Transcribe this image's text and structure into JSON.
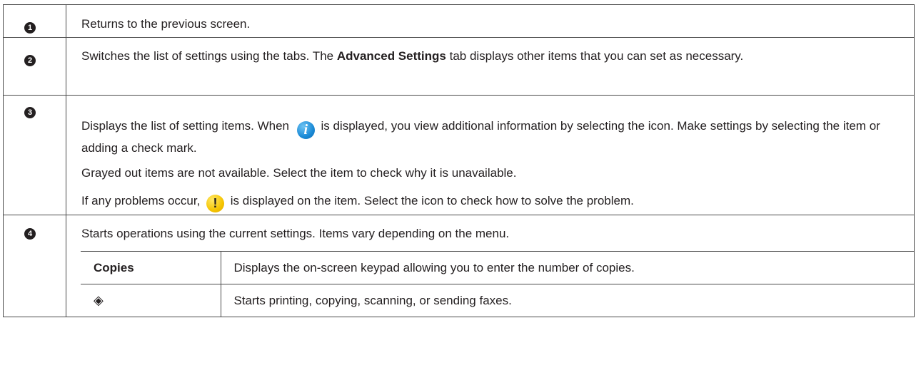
{
  "rows": [
    {
      "number": "1",
      "text": "Returns to the previous screen."
    },
    {
      "number": "2",
      "text_before": "Switches the list of settings using the tabs. The ",
      "text_bold": "Advanced Settings",
      "text_after": " tab displays other items that you can set as necessary."
    },
    {
      "number": "3",
      "p1_before": "Displays the list of setting items. When ",
      "p1_icon": "info-icon",
      "p1_after": " is displayed, you view additional information by selecting the icon. Make settings by selecting the item or adding a check mark.",
      "p2": "Grayed out items are not available. Select the item to check why it is unavailable.",
      "p3_before": "If any problems occur, ",
      "p3_icon": "warning-icon",
      "p3_after": " is displayed on the item. Select the icon to check how to solve the problem."
    },
    {
      "number": "4",
      "text": "Starts operations using the current settings. Items vary depending on the menu.",
      "sub_items": [
        {
          "label": "Copies",
          "description": "Displays the on-screen keypad allowing you to enter the number of copies."
        },
        {
          "label": "◈",
          "label_icon": "start-icon",
          "description": "Starts printing, copying, scanning, or sending faxes."
        }
      ]
    }
  ],
  "icons": {
    "info_glyph": "i",
    "warning_glyph": "!"
  },
  "colors": {
    "info": "#1a8ad6",
    "warning": "#f5c400",
    "border": "#4a4a4a",
    "text": "#231f20"
  }
}
